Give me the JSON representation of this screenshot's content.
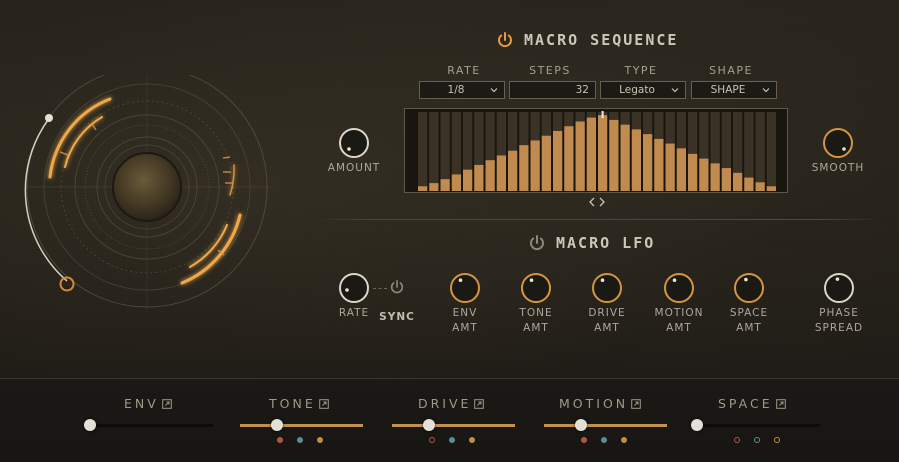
{
  "colors": {
    "accent": "#e59a3d",
    "accent_dim": "#b77c3a",
    "bar": "#c18a4f",
    "bar_dark": "#3a3225",
    "knob_ring": "#dcd6c8",
    "dot_red": "#b4544a",
    "dot_teal": "#5b8d97",
    "dot_orange": "#c98a45"
  },
  "macro_sequence": {
    "title": "MACRO SEQUENCE",
    "power_icon": "power-icon",
    "power_on": true,
    "rate": {
      "label": "RATE",
      "value": "1/8"
    },
    "steps": {
      "label": "STEPS",
      "value": "32"
    },
    "type": {
      "label": "TYPE",
      "value": "Legato"
    },
    "shape": {
      "label": "SHAPE",
      "value": "SHAPE"
    },
    "amount_label": "AMOUNT",
    "smooth_label": "SMOOTH",
    "step_values": [
      0.06,
      0.1,
      0.15,
      0.21,
      0.27,
      0.33,
      0.39,
      0.45,
      0.51,
      0.58,
      0.64,
      0.7,
      0.76,
      0.82,
      0.88,
      0.93,
      0.96,
      0.9,
      0.84,
      0.78,
      0.72,
      0.66,
      0.6,
      0.54,
      0.47,
      0.41,
      0.35,
      0.29,
      0.23,
      0.17,
      0.11,
      0.06
    ],
    "scroll_icon": "scroll-arrows-icon"
  },
  "macro_lfo": {
    "title": "MACRO LFO",
    "power_icon": "power-icon",
    "rate_label": "RATE",
    "sync_label": "SYNC",
    "knobs": [
      {
        "id": "env-amt",
        "line1": "ENV",
        "line2": "AMT"
      },
      {
        "id": "tone-amt",
        "line1": "TONE",
        "line2": "AMT"
      },
      {
        "id": "drive-amt",
        "line1": "DRIVE",
        "line2": "AMT"
      },
      {
        "id": "motion-amt",
        "line1": "MOTION",
        "line2": "AMT"
      },
      {
        "id": "space-amt",
        "line1": "SPACE",
        "line2": "AMT"
      },
      {
        "id": "phase-spread",
        "line1": "PHASE",
        "line2": "SPREAD"
      }
    ]
  },
  "bottom": {
    "slots": [
      {
        "label": "ENV",
        "value": 0.0,
        "dots": []
      },
      {
        "label": "TONE",
        "value": 0.3,
        "dots": [
          "dot_red",
          "dot_teal",
          "dot_orange"
        ]
      },
      {
        "label": "DRIVE",
        "value": 0.3,
        "dots": [
          "dot_red-o",
          "dot_teal",
          "dot_orange"
        ]
      },
      {
        "label": "MOTION",
        "value": 0.3,
        "dots": [
          "dot_red",
          "dot_teal",
          "dot_orange"
        ]
      },
      {
        "label": "SPACE",
        "value": 0.0,
        "dots": [
          "dot_red-o",
          "dot_teal-o",
          "dot_orange-o"
        ]
      }
    ]
  }
}
